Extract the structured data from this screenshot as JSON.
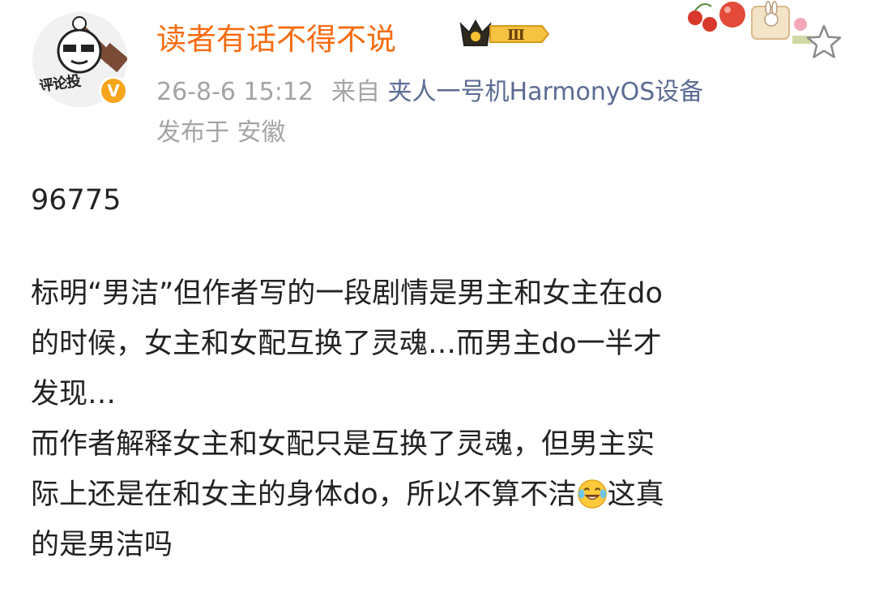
{
  "post": {
    "username": "读者有话不得不说",
    "vip_level": "Ⅲ",
    "avatar_caption": "评论投",
    "verify_mark": "V",
    "timestamp": "26-8-6 15:12",
    "from_label": "来自",
    "device": "夹人一号机HarmonyOS设备",
    "location": "发布于 安徽",
    "colors": {
      "username": "#f86c12",
      "device": "#5b6b93",
      "meta": "#a4a4a4"
    }
  },
  "content": {
    "number": "96775",
    "lines": [
      "标明“男洁”但作者写的一段剧情是男主和女主在do",
      "的时候，女主和女配互换了灵魂…而男主do一半才",
      "发现…",
      "而作者解释女主和女配只是互换了灵魂，但男主实",
      "际上还是在和女主的身体do，所以不算不洁",
      "这真",
      "的是男洁吗"
    ],
    "emoji": "laughing-crying-emoji"
  },
  "icons": {
    "favorite": "star-icon",
    "decoration": "cherry-bunny-decoration"
  }
}
